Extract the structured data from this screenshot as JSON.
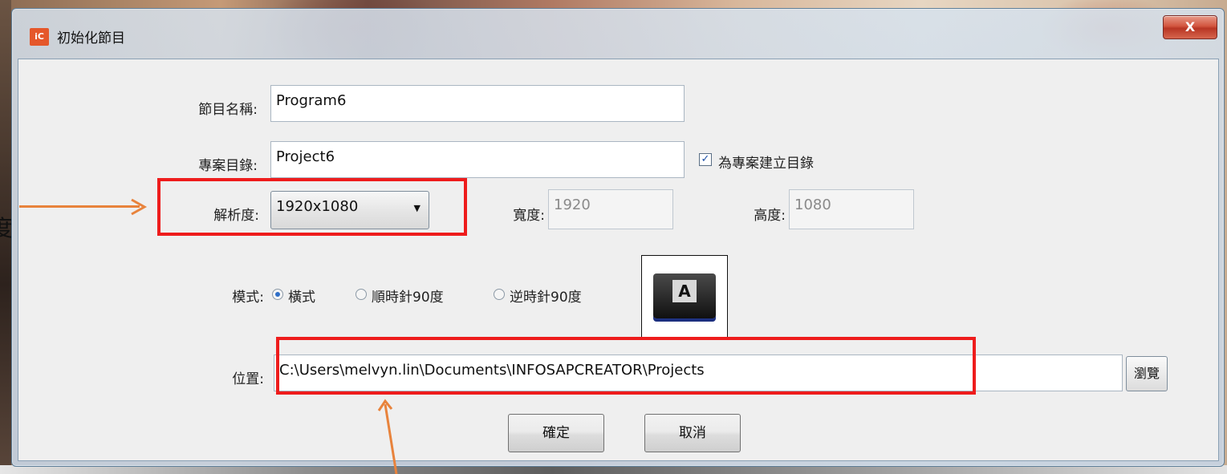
{
  "window": {
    "title": "初始化節目",
    "app_icon_text": "iC",
    "close_label": "X"
  },
  "form": {
    "program_name": {
      "label": "節目名稱:",
      "value": "Program6"
    },
    "project_dir": {
      "label": "專案目錄:",
      "value": "Project6",
      "checkbox_label": "為專案建立目錄",
      "checkbox_checked": true
    },
    "resolution": {
      "label": "解析度:",
      "selected": "1920x1080"
    },
    "width": {
      "label": "寬度:",
      "value": "1920"
    },
    "height": {
      "label": "高度:",
      "value": "1080"
    },
    "mode": {
      "label": "模式:",
      "options": [
        "橫式",
        "順時針90度",
        "逆時針90度"
      ],
      "selected": "橫式",
      "preview_letter": "A"
    },
    "location": {
      "label": "位置:",
      "value": "C:\\Users\\melvyn.lin\\Documents\\INFOSAPCREATOR\\Projects",
      "browse_label": "瀏覽"
    }
  },
  "buttons": {
    "ok": "確定",
    "cancel": "取消"
  },
  "annotations": {
    "cut_text": "度",
    "highlight_color": "#ee1c1c",
    "arrow_color": "#e8833c"
  }
}
